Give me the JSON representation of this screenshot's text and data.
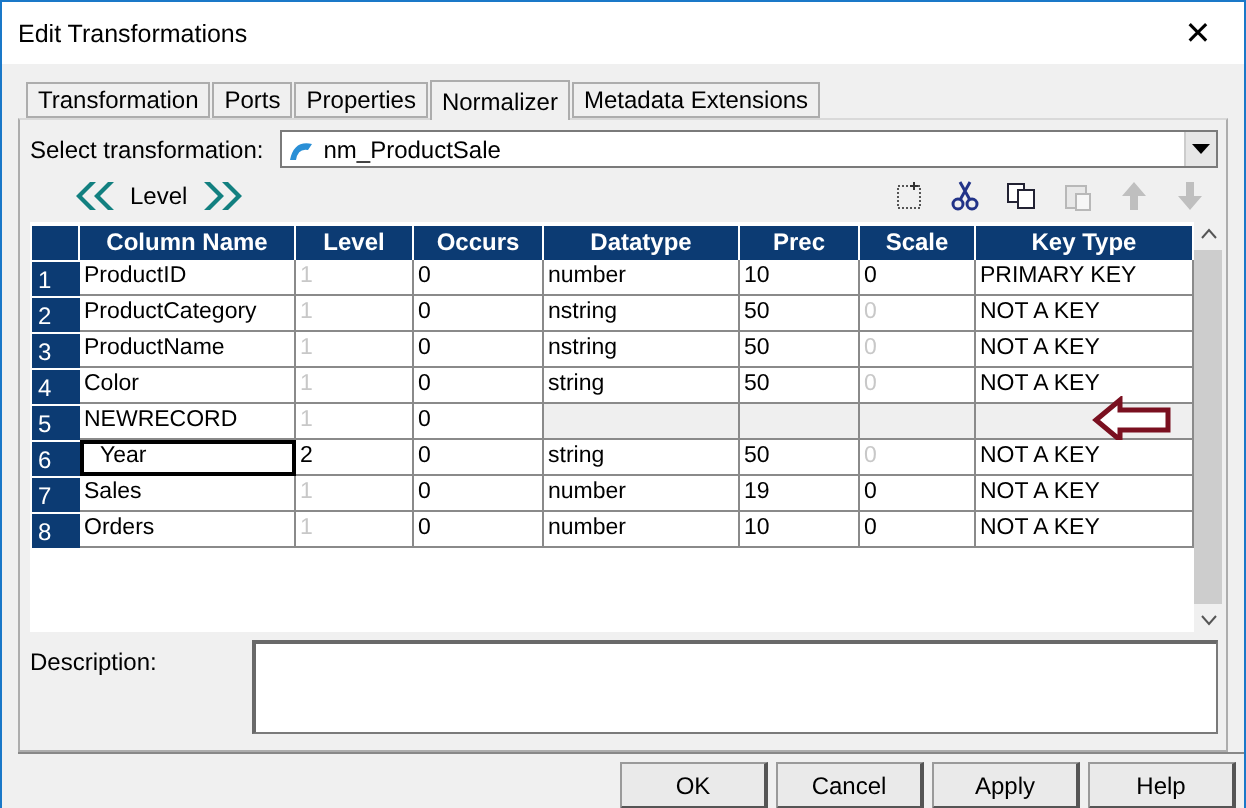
{
  "window": {
    "title": "Edit Transformations",
    "close": "✕"
  },
  "tabs": [
    {
      "label": "Transformation",
      "selected": false
    },
    {
      "label": "Ports",
      "selected": false
    },
    {
      "label": "Properties",
      "selected": false
    },
    {
      "label": "Normalizer",
      "selected": true
    },
    {
      "label": "Metadata Extensions",
      "selected": false
    }
  ],
  "select_transformation": {
    "label": "Select transformation:",
    "value": "nm_ProductSale"
  },
  "level_nav": {
    "label": "Level"
  },
  "toolbar": [
    {
      "kind": "new",
      "disabled": false
    },
    {
      "kind": "cut",
      "disabled": false
    },
    {
      "kind": "copy",
      "disabled": false
    },
    {
      "kind": "paste",
      "disabled": true
    },
    {
      "kind": "up",
      "disabled": true
    },
    {
      "kind": "down",
      "disabled": true
    }
  ],
  "table": {
    "columns": [
      "Column Name",
      "Level",
      "Occurs",
      "Datatype",
      "Prec",
      "Scale",
      "Key Type"
    ],
    "rows": [
      {
        "number": "1",
        "kind": "field",
        "selected": false,
        "cells": [
          {
            "text": "ProductID",
            "dimmed": false
          },
          {
            "text": "1",
            "dimmed": true
          },
          {
            "text": "0",
            "dimmed": false
          },
          {
            "text": "number",
            "dimmed": false
          },
          {
            "text": "10",
            "dimmed": false
          },
          {
            "text": "0",
            "dimmed": false
          },
          {
            "text": "PRIMARY KEY",
            "dimmed": false
          }
        ]
      },
      {
        "number": "2",
        "kind": "field",
        "selected": false,
        "cells": [
          {
            "text": "ProductCategory",
            "dimmed": false
          },
          {
            "text": "1",
            "dimmed": true
          },
          {
            "text": "0",
            "dimmed": false
          },
          {
            "text": "nstring",
            "dimmed": false
          },
          {
            "text": "50",
            "dimmed": false
          },
          {
            "text": "0",
            "dimmed": true
          },
          {
            "text": "NOT A KEY",
            "dimmed": false
          }
        ]
      },
      {
        "number": "3",
        "kind": "field",
        "selected": false,
        "cells": [
          {
            "text": "ProductName",
            "dimmed": false
          },
          {
            "text": "1",
            "dimmed": true
          },
          {
            "text": "0",
            "dimmed": false
          },
          {
            "text": "nstring",
            "dimmed": false
          },
          {
            "text": "50",
            "dimmed": false
          },
          {
            "text": "0",
            "dimmed": true
          },
          {
            "text": "NOT A KEY",
            "dimmed": false
          }
        ]
      },
      {
        "number": "4",
        "kind": "field",
        "selected": false,
        "cells": [
          {
            "text": "Color",
            "dimmed": false
          },
          {
            "text": "1",
            "dimmed": true
          },
          {
            "text": "0",
            "dimmed": false
          },
          {
            "text": "string",
            "dimmed": false
          },
          {
            "text": "50",
            "dimmed": false
          },
          {
            "text": "0",
            "dimmed": true
          },
          {
            "text": "NOT A KEY",
            "dimmed": false
          }
        ]
      },
      {
        "number": "5",
        "kind": "record",
        "selected": false,
        "cells": [
          {
            "text": "NEWRECORD",
            "dimmed": false
          },
          {
            "text": "1",
            "dimmed": true
          },
          {
            "text": "0",
            "dimmed": false
          }
        ],
        "children": [
          {
            "number": "6",
            "kind": "field",
            "selected": true,
            "cells": [
              {
                "text": "Year",
                "dimmed": false
              },
              {
                "text": "2",
                "dimmed": false
              },
              {
                "text": "0",
                "dimmed": false
              },
              {
                "text": "string",
                "dimmed": false
              },
              {
                "text": "50",
                "dimmed": false
              },
              {
                "text": "0",
                "dimmed": true
              },
              {
                "text": "NOT A KEY",
                "dimmed": false
              }
            ]
          }
        ]
      },
      {
        "number": "7",
        "kind": "field",
        "selected": false,
        "cells": [
          {
            "text": "Sales",
            "dimmed": false
          },
          {
            "text": "1",
            "dimmed": true
          },
          {
            "text": "0",
            "dimmed": false
          },
          {
            "text": "number",
            "dimmed": false
          },
          {
            "text": "19",
            "dimmed": false
          },
          {
            "text": "0",
            "dimmed": false
          },
          {
            "text": "NOT A KEY",
            "dimmed": false
          }
        ]
      },
      {
        "number": "8",
        "kind": "field",
        "selected": false,
        "cells": [
          {
            "text": "Orders",
            "dimmed": false
          },
          {
            "text": "1",
            "dimmed": true
          },
          {
            "text": "0",
            "dimmed": false
          },
          {
            "text": "number",
            "dimmed": false
          },
          {
            "text": "10",
            "dimmed": false
          },
          {
            "text": "0",
            "dimmed": false
          },
          {
            "text": "NOT A KEY",
            "dimmed": false
          }
        ]
      }
    ]
  },
  "description": {
    "label": "Description:"
  },
  "buttons": [
    "OK",
    "Cancel",
    "Apply",
    "Help"
  ]
}
